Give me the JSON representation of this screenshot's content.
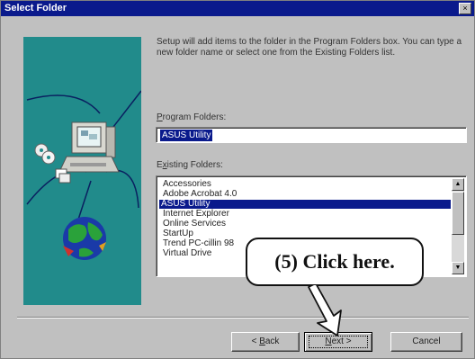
{
  "window": {
    "title": "Select Folder",
    "close_glyph": "×"
  },
  "description": "Setup will add items to the folder in the Program Folders box. You can type a new folder name or select one from the Existing Folders list.",
  "program_folders": {
    "label_accel": "P",
    "label_rest": "rogram Folders:",
    "value": "ASUS Utility"
  },
  "existing_folders": {
    "label_pre": "E",
    "label_accel": "x",
    "label_rest": "isting Folders:",
    "items": [
      "Accessories",
      "Adobe Acrobat 4.0",
      "ASUS Utility",
      "Internet Explorer",
      "Online Services",
      "StartUp",
      "Trend PC-cillin 98",
      "Virtual Drive"
    ],
    "selected_index": 2
  },
  "buttons": {
    "back_accel": "B",
    "back_pre": "< ",
    "back_rest": "ack",
    "next_accel": "N",
    "next_rest": "ext >",
    "cancel": "Cancel"
  },
  "callout": {
    "text": "(5)  Click here."
  },
  "colors": {
    "titlebar": "#0a1a8c",
    "selection": "#0a1a8c",
    "panel": "#218b8b",
    "face": "#c0c0c0"
  },
  "icons": [
    "close-icon",
    "computer-icon",
    "cd-icon",
    "globe-icon",
    "scroll-up-icon",
    "scroll-down-icon",
    "pointer-arrow-icon"
  ]
}
